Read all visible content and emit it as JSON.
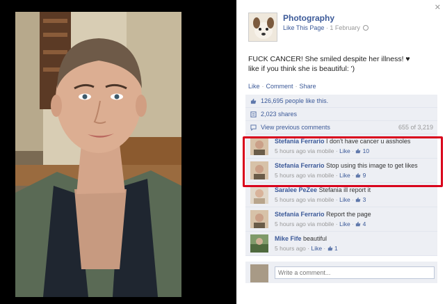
{
  "page": {
    "name": "Photography",
    "like_link": "Like This Page",
    "date": "1 February"
  },
  "post": {
    "text_line1": "FUCK CANCER! She smiled despite her illness! ♥",
    "text_line2": "like if you think she is beautiful: ')",
    "actions": {
      "like": "Like",
      "comment": "Comment",
      "share": "Share"
    }
  },
  "stats": {
    "likes": "126,695 people like this.",
    "shares": "2,023 shares",
    "view_previous": "View previous comments",
    "comment_count": "655 of 3,219"
  },
  "comments": [
    {
      "author": "Stefania Ferrario",
      "text": "I don't have cancer u assholes",
      "time": "5 hours ago via mobile",
      "like": "Like",
      "likes": "10"
    },
    {
      "author": "Stefania Ferrario",
      "text": "Stop using this image to get likes",
      "time": "5 hours ago via mobile",
      "like": "Like",
      "likes": "9"
    },
    {
      "author": "Saralee PeZee",
      "text": "Stefania ill report it",
      "time": "5 hours ago via mobile",
      "like": "Like",
      "likes": "3"
    },
    {
      "author": "Stefania Ferrario",
      "text": "Report the page",
      "time": "5 hours ago via mobile",
      "like": "Like",
      "likes": "4"
    },
    {
      "author": "Mike Fife",
      "text": "beautiful",
      "time": "5 hours ago",
      "like": "Like",
      "likes": "1"
    }
  ],
  "composer": {
    "placeholder": "Write a comment..."
  },
  "colors": {
    "link": "#3b5998",
    "highlight": "#d9001b",
    "ufi_bg": "#edeff4"
  },
  "icons": {
    "close": "close-icon",
    "like": "thumbs-up-icon",
    "share": "share-icon",
    "comment": "comment-icon",
    "globe": "globe-icon"
  }
}
